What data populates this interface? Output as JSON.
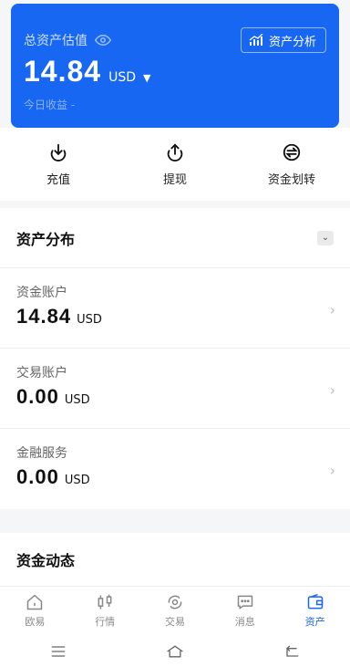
{
  "card": {
    "title": "总资产估值",
    "analysis_label": "资产分析",
    "amount": "14.84",
    "currency": "USD",
    "today_label": "今日收益 -",
    "colors": {
      "background": "#1767f2"
    }
  },
  "actions": [
    {
      "label": "充值",
      "icon": "deposit-icon"
    },
    {
      "label": "提现",
      "icon": "withdraw-icon"
    },
    {
      "label": "资金划转",
      "icon": "transfer-icon"
    }
  ],
  "distribution": {
    "title": "资产分布",
    "accounts": [
      {
        "name": "资金账户",
        "amount": "14.84",
        "currency": "USD"
      },
      {
        "name": "交易账户",
        "amount": "0.00",
        "currency": "USD"
      },
      {
        "name": "金融服务",
        "amount": "0.00",
        "currency": "USD"
      }
    ]
  },
  "activity": {
    "title": "资金动态"
  },
  "tabbar": {
    "items": [
      {
        "label": "欧易",
        "icon": "home-icon"
      },
      {
        "label": "行情",
        "icon": "candlestick-icon"
      },
      {
        "label": "交易",
        "icon": "trade-icon"
      },
      {
        "label": "消息",
        "icon": "message-icon"
      },
      {
        "label": "资产",
        "icon": "wallet-icon",
        "active": true
      }
    ],
    "active_color": "#1767f2"
  },
  "system_nav": [
    "menu-icon",
    "home-outline-icon",
    "back-icon"
  ]
}
